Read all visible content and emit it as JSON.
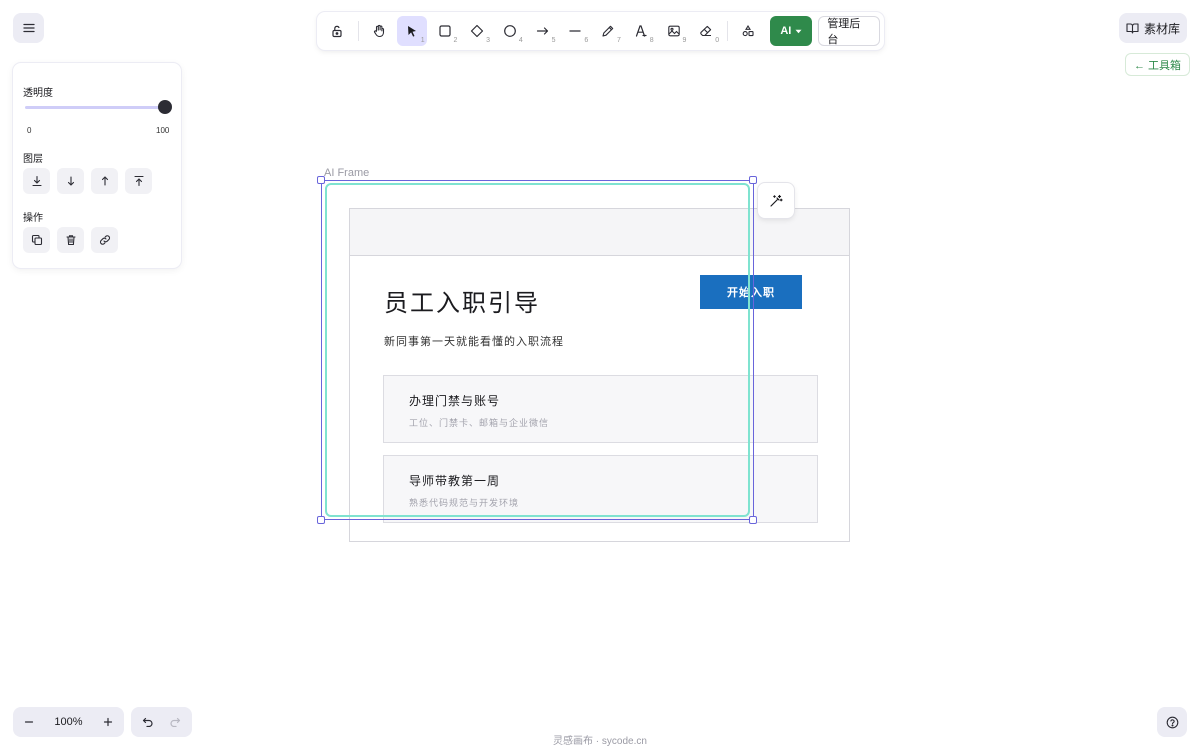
{
  "toolbar": {
    "tools": [
      {
        "icon": "lock-icon",
        "num": ""
      },
      {
        "icon": "hand-icon",
        "num": ""
      },
      {
        "icon": "pointer-icon",
        "num": "1"
      },
      {
        "icon": "rectangle-icon",
        "num": "2"
      },
      {
        "icon": "diamond-icon",
        "num": "3"
      },
      {
        "icon": "ellipse-icon",
        "num": "4"
      },
      {
        "icon": "arrow-icon",
        "num": "5"
      },
      {
        "icon": "line-icon",
        "num": "6"
      },
      {
        "icon": "pencil-icon",
        "num": "7"
      },
      {
        "icon": "text-icon",
        "num": "8"
      },
      {
        "icon": "image-icon",
        "num": "9"
      },
      {
        "icon": "eraser-icon",
        "num": "0"
      },
      {
        "icon": "shapes-library-icon",
        "num": ""
      }
    ],
    "active_tool": "pointer-icon",
    "ai_label": "AI",
    "admin_label": "管理后台"
  },
  "top_right": {
    "library_label": "素材库",
    "toolbox_label": "← 工具箱"
  },
  "properties": {
    "opacity_label": "透明度",
    "opacity_min": "0",
    "opacity_max": "100",
    "opacity_value": 100,
    "layers_label": "图层",
    "actions_label": "操作",
    "layer_icons": [
      "send-to-back-icon",
      "send-backward-icon",
      "bring-forward-icon",
      "bring-to-front-icon"
    ],
    "action_icons": [
      "duplicate-icon",
      "delete-icon",
      "link-icon"
    ]
  },
  "canvas": {
    "frame_label": "AI Frame",
    "mockup": {
      "title": "员工入职引导",
      "subtitle": "新同事第一天就能看懂的入职流程",
      "start_button": "开始入职",
      "cards": [
        {
          "title": "办理门禁与账号",
          "desc": "工位、门禁卡、邮箱与企业微信"
        },
        {
          "title": "导师带教第一周",
          "desc": "熟悉代码规范与开发环境"
        }
      ]
    }
  },
  "bottom": {
    "zoom_level": "100%",
    "footer": "灵感画布 · sycode.cn"
  },
  "colors": {
    "accent": "#6965db",
    "selection_bg": "#e0dfff",
    "ai_green": "#2f8a4b",
    "frame_teal": "#7fe3d0",
    "mockup_blue": "#1a6fbf"
  }
}
